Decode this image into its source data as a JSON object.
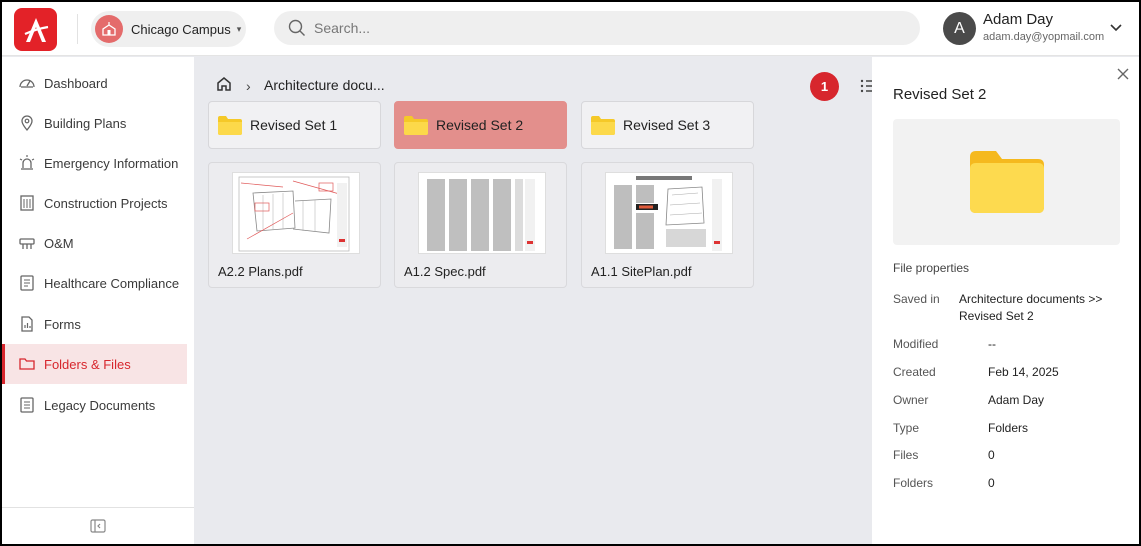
{
  "topbar": {
    "campus": "Chicago Campus",
    "search_placeholder": "Search...",
    "user_initial": "A",
    "user_name": "Adam Day",
    "user_email": "adam.day@yopmail.com"
  },
  "sidebar": {
    "items": [
      {
        "label": "Dashboard",
        "icon": "dashboard-gauge-icon"
      },
      {
        "label": "Building Plans",
        "icon": "map-pin-icon"
      },
      {
        "label": "Emergency Information",
        "icon": "alarm-light-icon"
      },
      {
        "label": "Construction Projects",
        "icon": "building-icon"
      },
      {
        "label": "O&M",
        "icon": "tools-icon"
      },
      {
        "label": "Healthcare Compliance",
        "icon": "checklist-icon"
      },
      {
        "label": "Forms",
        "icon": "form-chart-icon"
      },
      {
        "label": "Folders & Files",
        "icon": "folder-icon",
        "active": true
      },
      {
        "label": "Legacy Documents",
        "icon": "documents-icon"
      }
    ]
  },
  "main": {
    "breadcrumb": "Architecture docu...",
    "badge": "1",
    "folders": [
      "Revised Set 1",
      "Revised Set 2",
      "Revised Set 3"
    ],
    "selected_folder": "Revised Set 2",
    "files": [
      "A2.2 Plans.pdf",
      "A1.2 Spec.pdf",
      "A1.1 SitePlan.pdf"
    ]
  },
  "panel": {
    "title": "Revised Set 2",
    "properties_heading": "File properties",
    "saved_in_label": "Saved in",
    "saved_in_line1": "Architecture documents >>",
    "saved_in_line2": "Revised Set 2",
    "props": [
      {
        "label": "Modified",
        "value": "--"
      },
      {
        "label": "Created",
        "value": "Feb 14, 2025"
      },
      {
        "label": "Owner",
        "value": "Adam Day"
      },
      {
        "label": "Type",
        "value": "Folders"
      },
      {
        "label": "Files",
        "value": "0"
      },
      {
        "label": "Folders",
        "value": "0"
      }
    ]
  },
  "colors": {
    "brand": "#e32228",
    "active_text": "#d7262d",
    "active_bg": "#f8e4e5",
    "selected_folder": "#e38f8c",
    "folder": "#fcd94a"
  }
}
